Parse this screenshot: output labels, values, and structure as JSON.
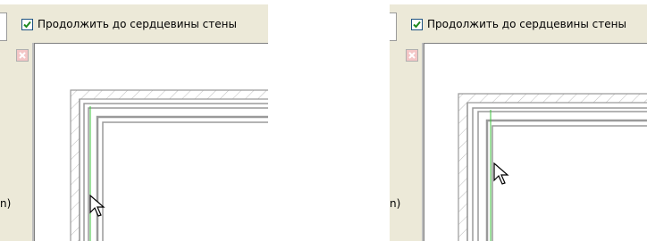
{
  "panels": [
    {
      "checkbox_label": "Продолжить до сердцевины стены",
      "checkbox_checked": true,
      "side_text": "n)"
    },
    {
      "checkbox_label": "Продолжить до сердцевины стены",
      "checkbox_checked": true,
      "side_text": "n)"
    }
  ],
  "colors": {
    "toolbar_bg": "#ece9d8",
    "wall_line": "#9a9a9a",
    "core_line": "#3cc43c",
    "checkmark": "#1f8a1f"
  }
}
